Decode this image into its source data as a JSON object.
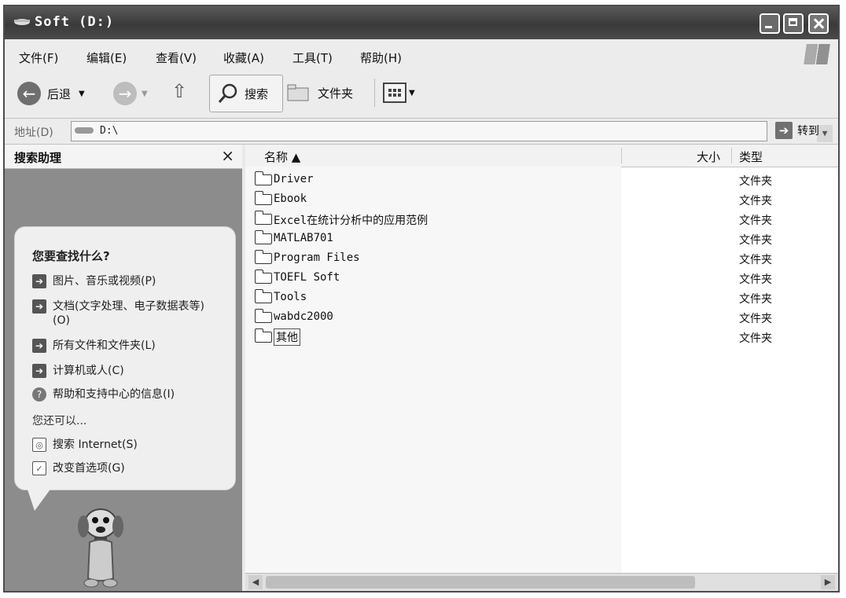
{
  "window": {
    "title": "Soft (D:)"
  },
  "menubar": {
    "items": [
      "文件(F)",
      "编辑(E)",
      "查看(V)",
      "收藏(A)",
      "工具(T)",
      "帮助(H)"
    ]
  },
  "toolbar": {
    "back_label": "后退",
    "search_label": "搜索",
    "folders_label": "文件夹"
  },
  "address": {
    "label": "地址(D)",
    "value": "D:\\",
    "go_label": "转到"
  },
  "search_pane": {
    "title": "搜索助理",
    "close_glyph": "×",
    "question": "您要查找什么?",
    "options": [
      "图片、音乐或视频(P)",
      "文档(文字处理、电子数据表等)(O)",
      "所有文件和文件夹(L)",
      "计算机或人(C)",
      "帮助和支持中心的信息(I)"
    ],
    "also_label": "您还可以...",
    "more_options": [
      "搜索 Internet(S)",
      "改变首选项(G)"
    ]
  },
  "file_list": {
    "columns": {
      "name": "名称 ▲",
      "size": "大小",
      "type": "类型"
    },
    "rows": [
      {
        "name": "Driver",
        "type": "文件夹"
      },
      {
        "name": "Ebook",
        "type": "文件夹"
      },
      {
        "name": "Excel在统计分析中的应用范例",
        "type": "文件夹"
      },
      {
        "name": "MATLAB701",
        "type": "文件夹"
      },
      {
        "name": "Program Files",
        "type": "文件夹"
      },
      {
        "name": "TOEFL Soft",
        "type": "文件夹"
      },
      {
        "name": "Tools",
        "type": "文件夹"
      },
      {
        "name": "wabdc2000",
        "type": "文件夹"
      },
      {
        "name": "其他",
        "type": "文件夹"
      }
    ]
  }
}
